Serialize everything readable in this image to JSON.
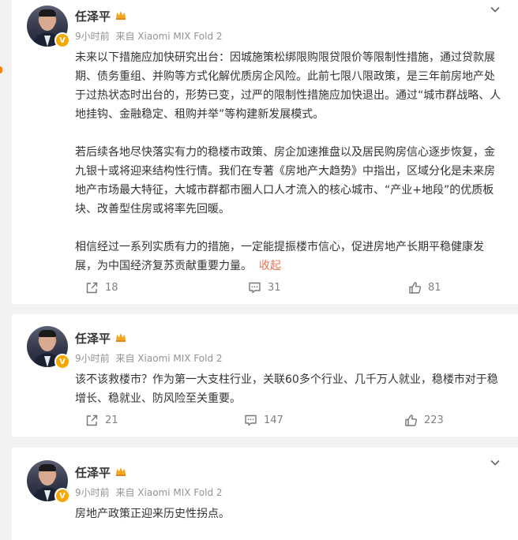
{
  "posts": [
    {
      "author": "任泽平",
      "time": "9小时前",
      "source": "来自 Xiaomi MIX Fold 2",
      "paragraphs": [
        "未来以下措施应加快研究出台：因城施策松绑限购限贷限价等限制性措施，通过贷款展期、债务重组、并购等方式化解优质房企风险。此前七限八限政策，是三年前房地产处于过热状态时出台的，形势已变，过严的限制性措施应加快退出。通过“城市群战略、人地挂钩、金融稳定、租购并举”等构建新发展模式。",
        "若后续各地尽快落实有力的稳楼市政策、房企加速推盘以及居民购房信心逐步恢复，金九银十或将迎来结构性行情。我们在专著《房地产大趋势》中指出，区域分化是未来房地产市场最大特征，大城市群都市圈人口人才流入的核心城市、“产业+地段”的优质板块、改善型住房或将率先回暖。",
        "相信经过一系列实质有力的措施，一定能提振楼市信心，促进房地产长期平稳健康发展，为中国经济复苏贡献重要力量。"
      ],
      "collapse_label": "收起",
      "shares": "18",
      "comments": "31",
      "likes": "81"
    },
    {
      "author": "任泽平",
      "time": "9小时前",
      "source": "来自 Xiaomi MIX Fold 2",
      "paragraphs": [
        "该不该救楼市？作为第一大支柱行业，关联60多个行业、几千万人就业，稳楼市对于稳增长、稳就业、防风险至关重要。"
      ],
      "shares": "21",
      "comments": "147",
      "likes": "223"
    },
    {
      "author": "任泽平",
      "time": "9小时前",
      "source": "来自 Xiaomi MIX Fold 2",
      "paragraphs": [
        "房地产政策正迎来历史性拐点。"
      ]
    }
  ],
  "icons": {
    "verified": "verified-badge-icon",
    "crown": "member-crown-icon",
    "chevron": "chevron-down-icon",
    "share": "share-icon",
    "comment": "comment-icon",
    "like": "like-icon"
  },
  "colors": {
    "accent": "#eb7350",
    "verified": "#f7a800",
    "meta": "#939393",
    "background": "#f2f2f2"
  }
}
